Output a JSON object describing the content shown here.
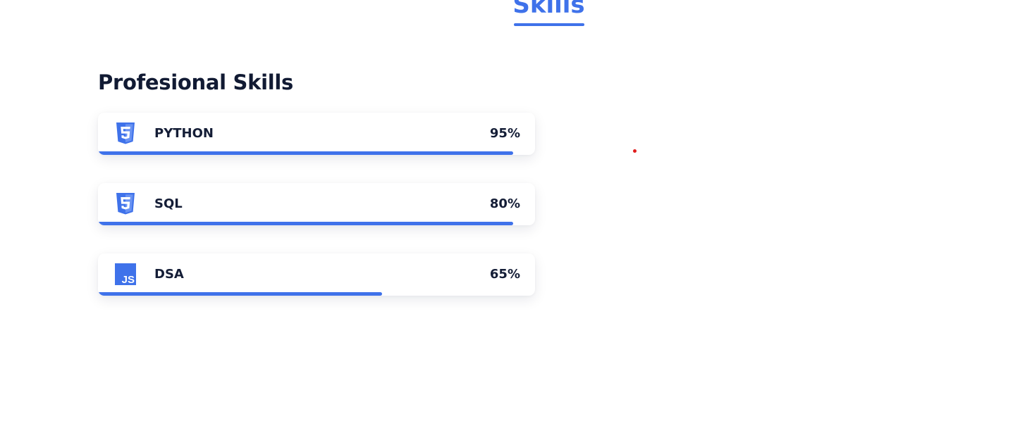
{
  "section": {
    "title": "Skills"
  },
  "subsection": {
    "title": "Profesional Skills"
  },
  "skills": [
    {
      "name": "PYTHON",
      "percent_label": "95%",
      "icon": "html5-icon",
      "bar_fill_fraction": 0.95
    },
    {
      "name": "SQL",
      "percent_label": "80%",
      "icon": "html5-icon",
      "bar_fill_fraction": 0.95
    },
    {
      "name": "DSA",
      "percent_label": "65%",
      "icon": "js-icon",
      "bar_fill_fraction": 0.65
    }
  ],
  "colors": {
    "accent": "#3f72ea",
    "heading": "#111a33",
    "text": "#141d36",
    "cursor": "#e11d1d",
    "background": "#ffffff"
  }
}
